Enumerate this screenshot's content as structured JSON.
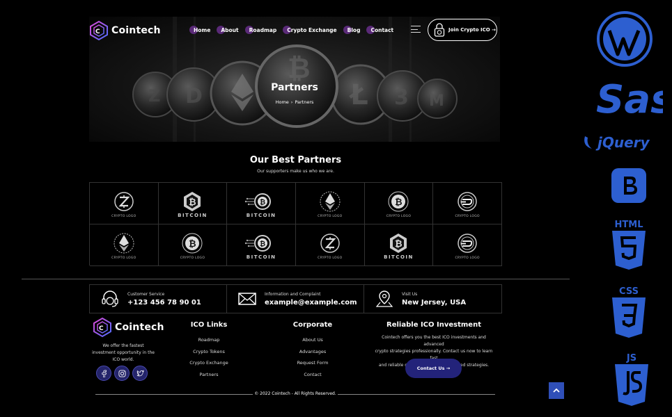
{
  "brand": {
    "name": "Cointech"
  },
  "nav": {
    "items": [
      "Home",
      "About",
      "Roadmap",
      "Crypto Exchange",
      "Blog",
      "Contact"
    ],
    "join_label": "Join Crypto ICO →"
  },
  "hero": {
    "title": "Partners",
    "breadcrumb": {
      "home": "Home",
      "sep": "›",
      "current": "Partners"
    }
  },
  "partners": {
    "title": "Our Best Partners",
    "subtitle": "Our supporters make us who we are.",
    "logos": [
      {
        "icon": "zcash-icon",
        "label": "CRYPTO LOGO"
      },
      {
        "icon": "bitcoin-hex-icon",
        "label": "BITCOIN"
      },
      {
        "icon": "bitcoin-circuit-icon",
        "label": "BITCOIN"
      },
      {
        "icon": "ethereum-icon",
        "label": "CRYPTO LOGO"
      },
      {
        "icon": "bitcoin-icon",
        "label": "CRYPTO LOGO"
      },
      {
        "icon": "dash-icon",
        "label": "CRYPTO LOGO"
      },
      {
        "icon": "ethereum-icon",
        "label": "CRYPTO LOGO"
      },
      {
        "icon": "bitcoin-icon",
        "label": "CRYPTO LOGO"
      },
      {
        "icon": "bitcoin-circuit-icon",
        "label": "BITCOIN"
      },
      {
        "icon": "zcash-icon",
        "label": "CRYPTO LOGO"
      },
      {
        "icon": "bitcoin-hex-icon",
        "label": "BITCOIN"
      },
      {
        "icon": "dash-icon",
        "label": "CRYPTO LOGO"
      }
    ]
  },
  "contact": {
    "service": {
      "label": "Customer Service",
      "value": "+123 456 78 90 01"
    },
    "info": {
      "label": "Information and Complaint",
      "value": "example@example.com"
    },
    "visit": {
      "label": "Visit Us",
      "value": "New Jersey, USA"
    }
  },
  "footer": {
    "desc_lines": [
      "We offer the fastest",
      "investment opportunity in the",
      "ICO world."
    ],
    "ico_links": {
      "title": "ICO Links",
      "items": [
        "Roadmap",
        "Crypto Tokens",
        "Crypto Exchange",
        "Partners"
      ]
    },
    "corporate": {
      "title": "Corporate",
      "items": [
        "About Us",
        "Advantages",
        "Request Form",
        "Contact"
      ]
    },
    "reliable": {
      "title": "Reliable ICO Investment",
      "lines": [
        "Cointech offers you the best ICO investments and advanced",
        "crypto strategies professionally. Contact us now to learn fast",
        "and reliable crypto trading and advanced strategies."
      ],
      "button": "Contact Us →"
    },
    "copyright": "© 2022 Cointech - All Rights Reserved."
  },
  "tech_labels": {
    "sass": "Sass",
    "jquery": "jQuery",
    "html": "HTML",
    "css": "CSS",
    "js": "JS"
  },
  "colors": {
    "accent": "#23237a",
    "menu_dot": "#5a2a78",
    "tech_blue": "#2d5fd0"
  }
}
